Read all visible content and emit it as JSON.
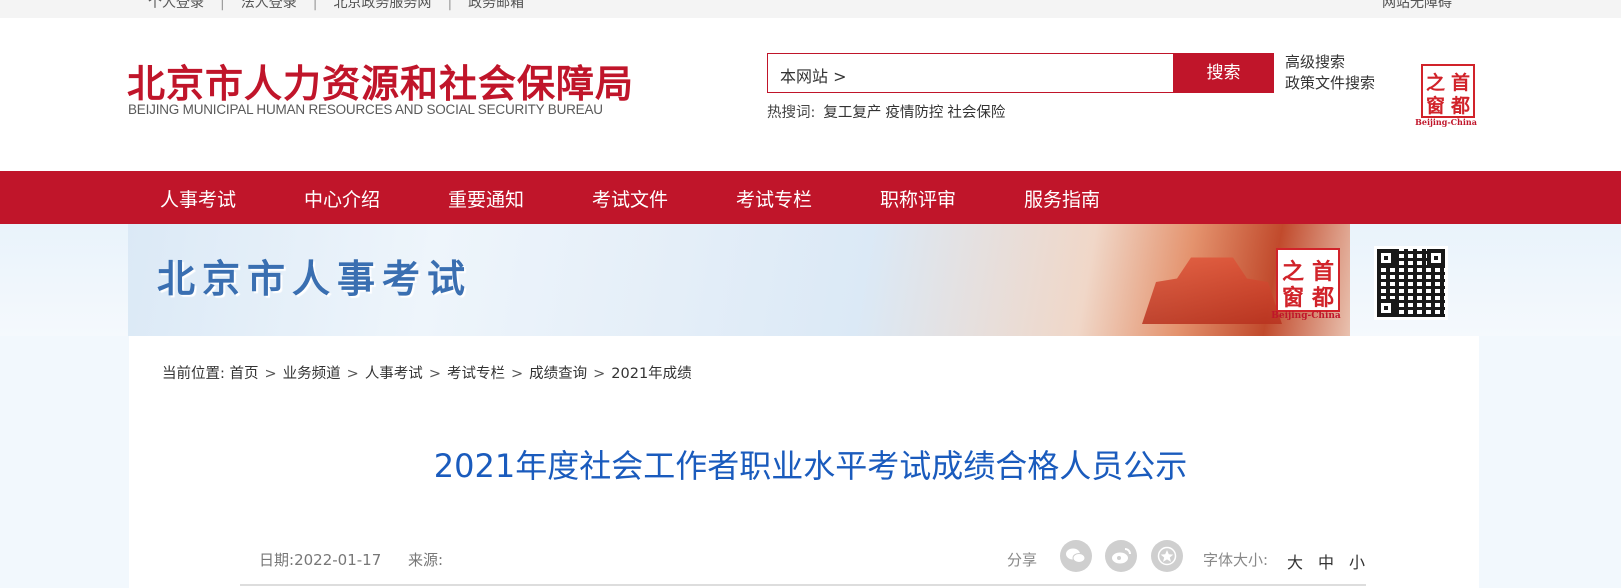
{
  "topbar": {
    "links": [
      "个人登录",
      "法人登录",
      "北京政务服务网",
      "政务邮箱"
    ],
    "right": "网站无障碍"
  },
  "header": {
    "logo_cn": "北京市人力资源和社会保障局",
    "logo_en": "BEIJING MUNICIPAL HUMAN RESOURCES AND SOCIAL SECURITY BUREAU",
    "search_scope": "本网站 >",
    "search_button": "搜索",
    "advanced_search": "高级搜索",
    "policy_search": "政策文件搜索",
    "hot_label": "热搜词:",
    "hot_keywords": [
      "复工复产",
      "疫情防控",
      "社会保险"
    ],
    "badge": {
      "chars": [
        "之",
        "首",
        "窗",
        "都"
      ],
      "caption": "Beijing-China"
    }
  },
  "nav": {
    "items": [
      "人事考试",
      "中心介绍",
      "重要通知",
      "考试文件",
      "考试专栏",
      "职称评审",
      "服务指南"
    ]
  },
  "banner": {
    "title": "北京市人事考试",
    "badge": {
      "chars": [
        "之",
        "首",
        "窗",
        "都"
      ],
      "caption": "Beijing-China"
    }
  },
  "breadcrumb": {
    "label": "当前位置:",
    "items": [
      "首页",
      "业务频道",
      "人事考试",
      "考试专栏",
      "成绩查询",
      "2021年成绩"
    ]
  },
  "article": {
    "title": "2021年度社会工作者职业水平考试成绩合格人员公示",
    "date_label": "日期:",
    "date": "2022-01-17",
    "source_label": "来源:",
    "share_label": "分享",
    "share_icons": [
      "wechat-icon",
      "weibo-icon",
      "star-icon"
    ],
    "font_size_label": "字体大小:",
    "font_sizes": [
      "大",
      "中",
      "小"
    ]
  },
  "colors": {
    "brand_red": "#c0152a",
    "title_blue": "#1a5bbd",
    "banner_blue": "#3a6fb1"
  }
}
